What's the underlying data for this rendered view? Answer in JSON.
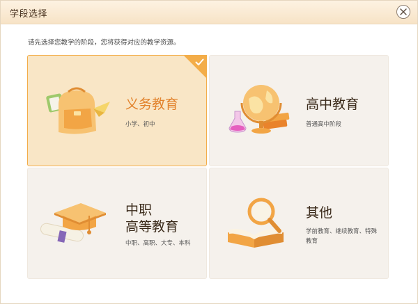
{
  "window": {
    "title": "学段选择"
  },
  "hint": "请先选择您教学的阶段，您将获得对应的教学资源。",
  "cards": [
    {
      "title": "义务教育",
      "subtitle": "小学、初中",
      "icon": "backpack-icon",
      "selected": true
    },
    {
      "title": "高中教育",
      "subtitle": "普通高中阶段",
      "icon": "globe-icon",
      "selected": false
    },
    {
      "title": "中职\n高等教育",
      "subtitle": "中职、高职、大专、本科",
      "icon": "graduation-cap-icon",
      "selected": false
    },
    {
      "title": "其他",
      "subtitle": "学前教育、继续教育、特殊教育",
      "icon": "magnifier-book-icon",
      "selected": false
    }
  ],
  "colors": {
    "accent": "#f3ad49",
    "selected_bg": "#f9e6c6",
    "card_bg": "#f5f1ec"
  }
}
